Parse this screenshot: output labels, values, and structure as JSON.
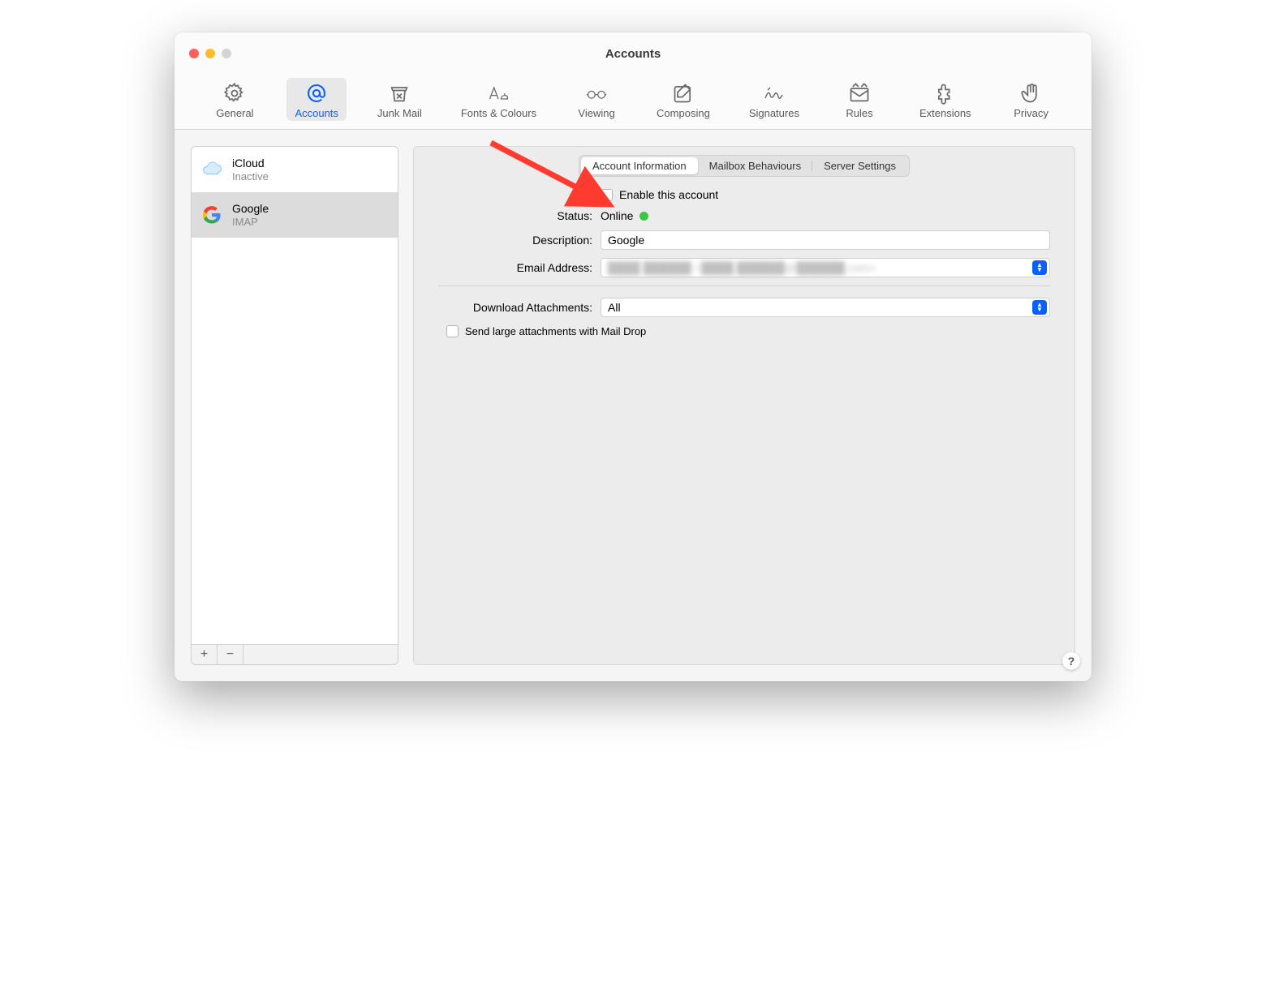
{
  "window": {
    "title": "Accounts"
  },
  "toolbar": [
    {
      "id": "general",
      "label": "General"
    },
    {
      "id": "accounts",
      "label": "Accounts"
    },
    {
      "id": "junk",
      "label": "Junk Mail"
    },
    {
      "id": "fonts",
      "label": "Fonts & Colours"
    },
    {
      "id": "viewing",
      "label": "Viewing"
    },
    {
      "id": "composing",
      "label": "Composing"
    },
    {
      "id": "signatures",
      "label": "Signatures"
    },
    {
      "id": "rules",
      "label": "Rules"
    },
    {
      "id": "extensions",
      "label": "Extensions"
    },
    {
      "id": "privacy",
      "label": "Privacy"
    }
  ],
  "toolbar_selected": "accounts",
  "accounts": [
    {
      "name": "iCloud",
      "sub": "Inactive",
      "icon": "icloud"
    },
    {
      "name": "Google",
      "sub": "IMAP",
      "icon": "google"
    }
  ],
  "accounts_selected_index": 1,
  "segments": [
    "Account Information",
    "Mailbox Behaviours",
    "Server Settings"
  ],
  "segment_active_index": 0,
  "form": {
    "enable_label": "Enable this account",
    "enable_checked": false,
    "status_label": "Status:",
    "status_value": "Online",
    "status_color": "#3bc641",
    "description_label": "Description:",
    "description_value": "Google",
    "email_label": "Email Address:",
    "email_value_blurred": true,
    "download_label": "Download Attachments:",
    "download_value": "All",
    "maildrop_label": "Send large attachments with Mail Drop",
    "maildrop_checked": false
  },
  "sidebar_buttons": {
    "add": "+",
    "remove": "−"
  },
  "help_label": "?",
  "annotation": {
    "arrow_color": "#ff3b30"
  }
}
